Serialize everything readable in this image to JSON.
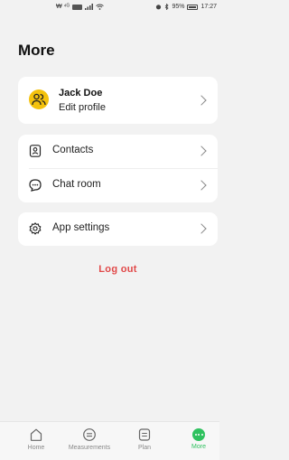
{
  "status_bar": {
    "carrier_text": "₩ ⁴ᴳ",
    "time": "17:27",
    "battery": "95%"
  },
  "header": {
    "title": "More"
  },
  "profile": {
    "name": "Jack Doe",
    "subtitle": "Edit profile"
  },
  "menu": {
    "contacts": "Contacts",
    "chat_room": "Chat room",
    "app_settings": "App settings"
  },
  "logout_label": "Log out",
  "bottom_nav": [
    {
      "label": "Home",
      "icon": "home-icon"
    },
    {
      "label": "Measurements",
      "icon": "measurements-icon"
    },
    {
      "label": "Plan",
      "icon": "plan-icon"
    },
    {
      "label": "More",
      "icon": "more-icon",
      "active": true
    }
  ],
  "colors": {
    "accent": "#2fc15f",
    "logout": "#e14848",
    "avatar": "#f4c20d",
    "background": "#f2f2f2"
  }
}
